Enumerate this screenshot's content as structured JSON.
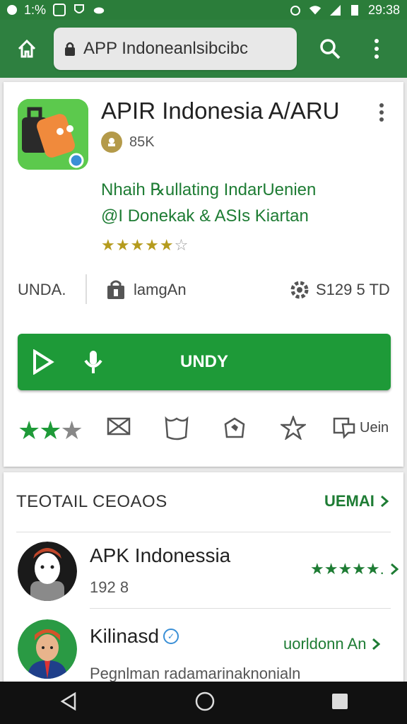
{
  "status_bar": {
    "time": "29:38",
    "left_text": "1:%"
  },
  "toolbar": {
    "url": "APP Indoneanlsibcibc"
  },
  "app": {
    "title": "APIR Indonesia A/ARU",
    "developer_count": "85K",
    "description_line1": "Nhaih ℞ullating IndarUenien",
    "description_line2": "@I Donekak & ASIs Kiartan",
    "stars": "★★★★★",
    "stars_empty": "☆",
    "info_a": "UNDA.",
    "info_b": "lamgAn",
    "info_c": "S129 5 TD",
    "install_label": "UNDY",
    "share_label": "Uein"
  },
  "reviews": {
    "title": "TEOTAIL CEOAOS",
    "more_label": "UEMAI",
    "items": [
      {
        "name": "APK Indonessia",
        "sub": "192  8",
        "right": "★★★★★."
      },
      {
        "name": "Kilinasd",
        "sub": "Pegnlman radamarinaknonialn",
        "right": "uorldonn An"
      }
    ]
  },
  "colors": {
    "brand_green": "#1e9a38",
    "toolbar_green": "#2e8040",
    "status_green": "#2b7d3a"
  }
}
